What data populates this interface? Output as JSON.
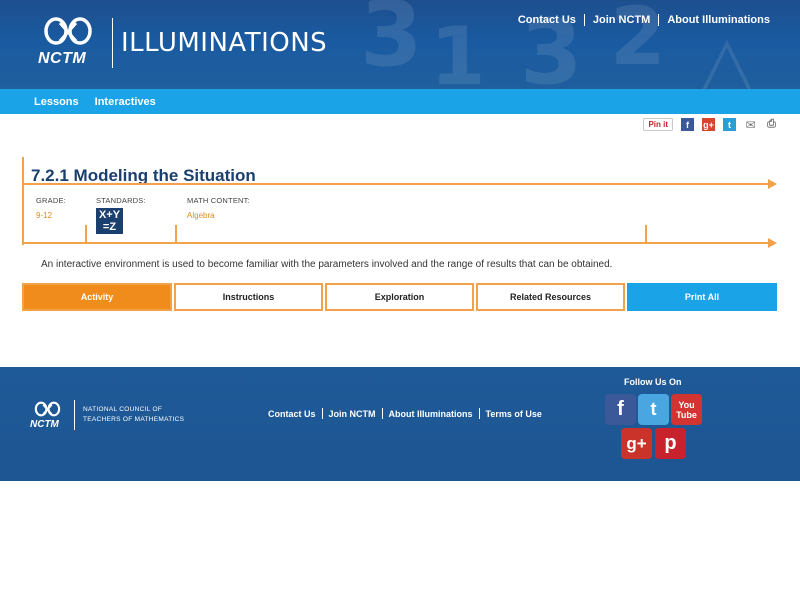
{
  "header": {
    "logo_text": "NCTM",
    "brand": "ILLUMINATIONS",
    "links": [
      "Contact Us",
      "Join NCTM",
      "About Illuminations"
    ]
  },
  "nav": {
    "items": [
      "Lessons",
      "Interactives"
    ]
  },
  "share": {
    "pinit": "Pin it"
  },
  "lesson": {
    "title": "7.2.1 Modeling the Situation",
    "grade_label": "GRADE:",
    "grade": "9-12",
    "standards_label": "STANDARDS:",
    "standards_icon_text": "X+Y =Z",
    "content_label": "MATH CONTENT:",
    "content": "Algebra",
    "description": "An interactive environment is used to become familiar with the parameters involved and the range of results that can be obtained."
  },
  "tabs": [
    "Activity",
    "Instructions",
    "Exploration",
    "Related Resources",
    "Print All"
  ],
  "footer": {
    "logo_text": "NCTM",
    "org_line1": "NATIONAL COUNCIL OF",
    "org_line2": "TEACHERS OF MATHEMATICS",
    "links": [
      "Contact Us",
      "Join NCTM",
      "About Illuminations",
      "Terms of Use"
    ],
    "follow": "Follow Us On"
  },
  "colors": {
    "header_blue": "#1d4f8e",
    "nav_blue": "#1aa3e6",
    "accent_orange": "#f08c1c",
    "title_navy": "#1b3f6e"
  }
}
